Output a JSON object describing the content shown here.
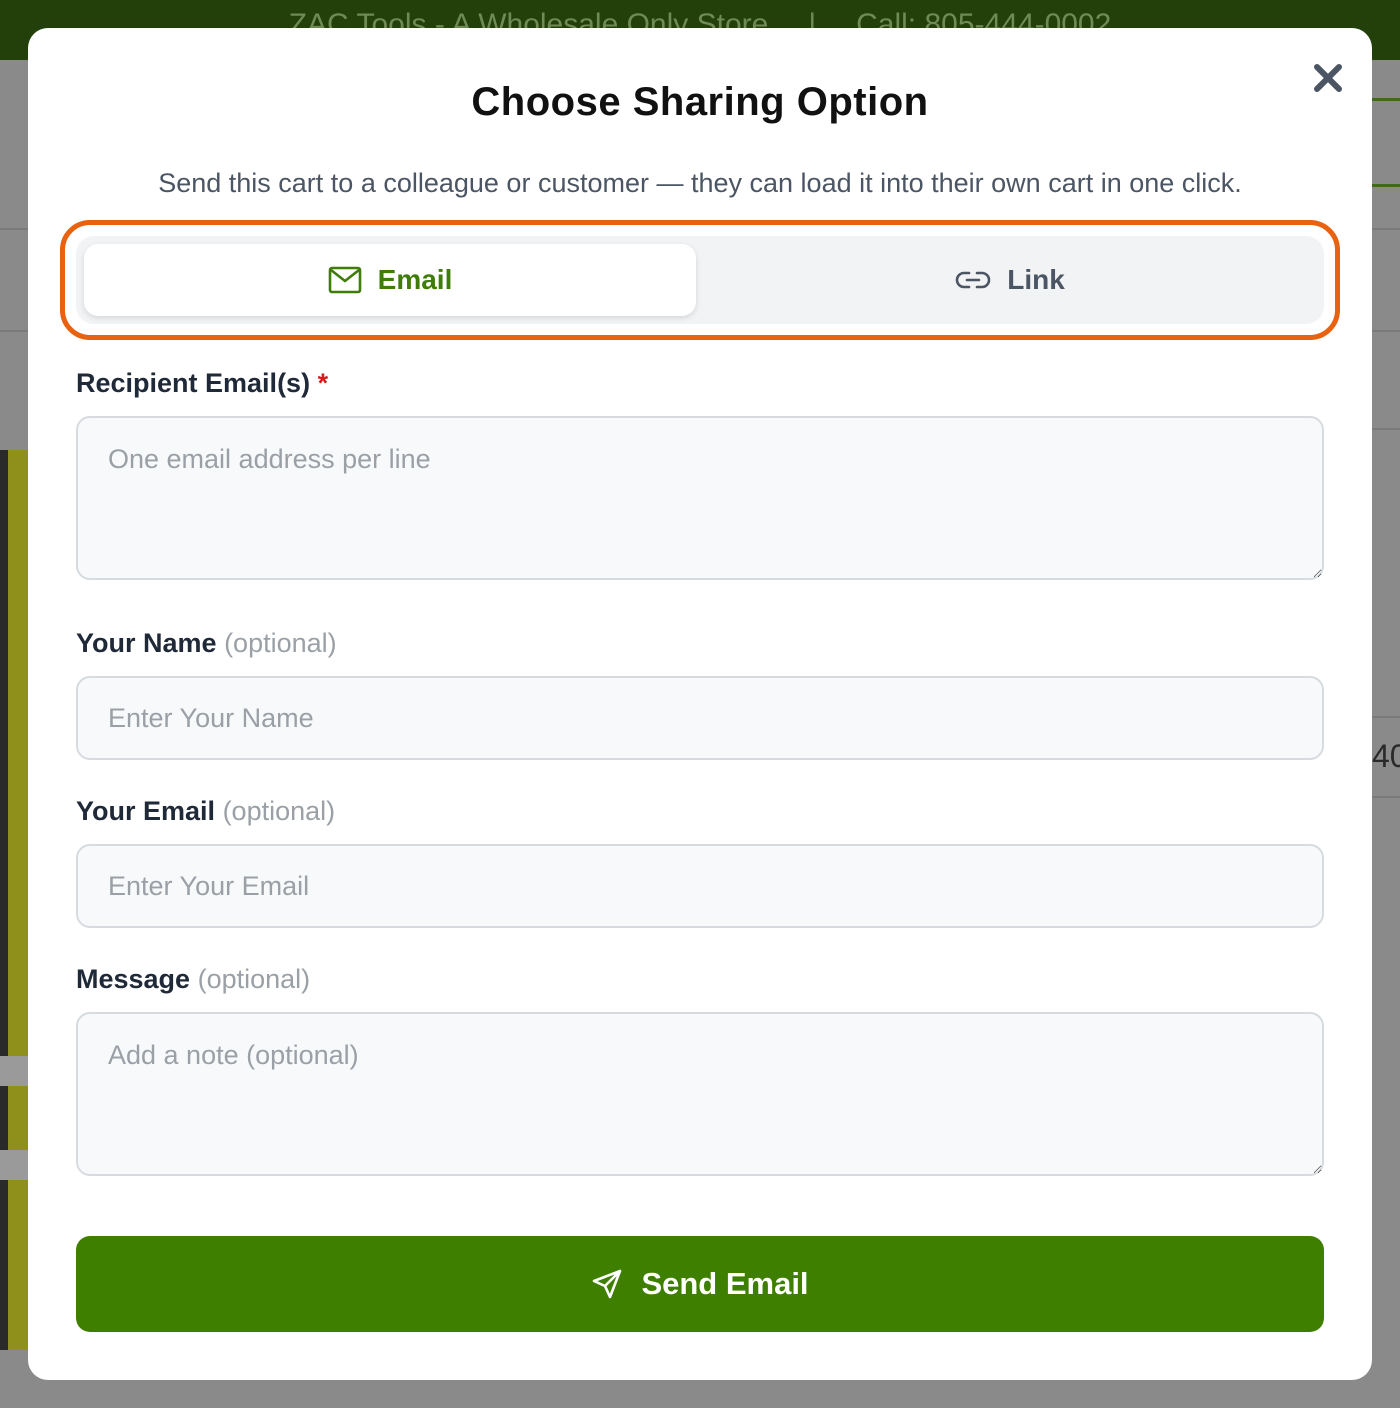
{
  "background": {
    "topbar": {
      "store": "ZAC Tools - A Wholesale Only Store",
      "separator": "|",
      "phone": "Call: 805-444-0002"
    },
    "partial_number": "40"
  },
  "modal": {
    "title": "Choose Sharing Option",
    "subtitle": "Send this cart to a colleague or customer — they can load it into their own cart in one click.",
    "close_icon": "close-icon"
  },
  "tabs": [
    {
      "label": "Email",
      "icon": "mail-icon",
      "active": true
    },
    {
      "label": "Link",
      "icon": "link-icon",
      "active": false
    }
  ],
  "form": {
    "recipients": {
      "label": "Recipient Email(s)",
      "required_mark": "*",
      "placeholder": "One email address per line",
      "value": ""
    },
    "name": {
      "label": "Your Name",
      "optional": "(optional)",
      "placeholder": "Enter Your Name",
      "value": ""
    },
    "email": {
      "label": "Your Email",
      "optional": "(optional)",
      "placeholder": "Enter Your Email",
      "value": ""
    },
    "message": {
      "label": "Message",
      "optional": "(optional)",
      "placeholder": "Add a note (optional)",
      "value": ""
    }
  },
  "submit": {
    "label": "Send Email",
    "icon": "send-icon"
  },
  "colors": {
    "accent_green": "#3f7f00",
    "active_tab_text": "#3f7d08",
    "highlight_orange": "#e8620f",
    "required_red": "#d91a1a"
  }
}
